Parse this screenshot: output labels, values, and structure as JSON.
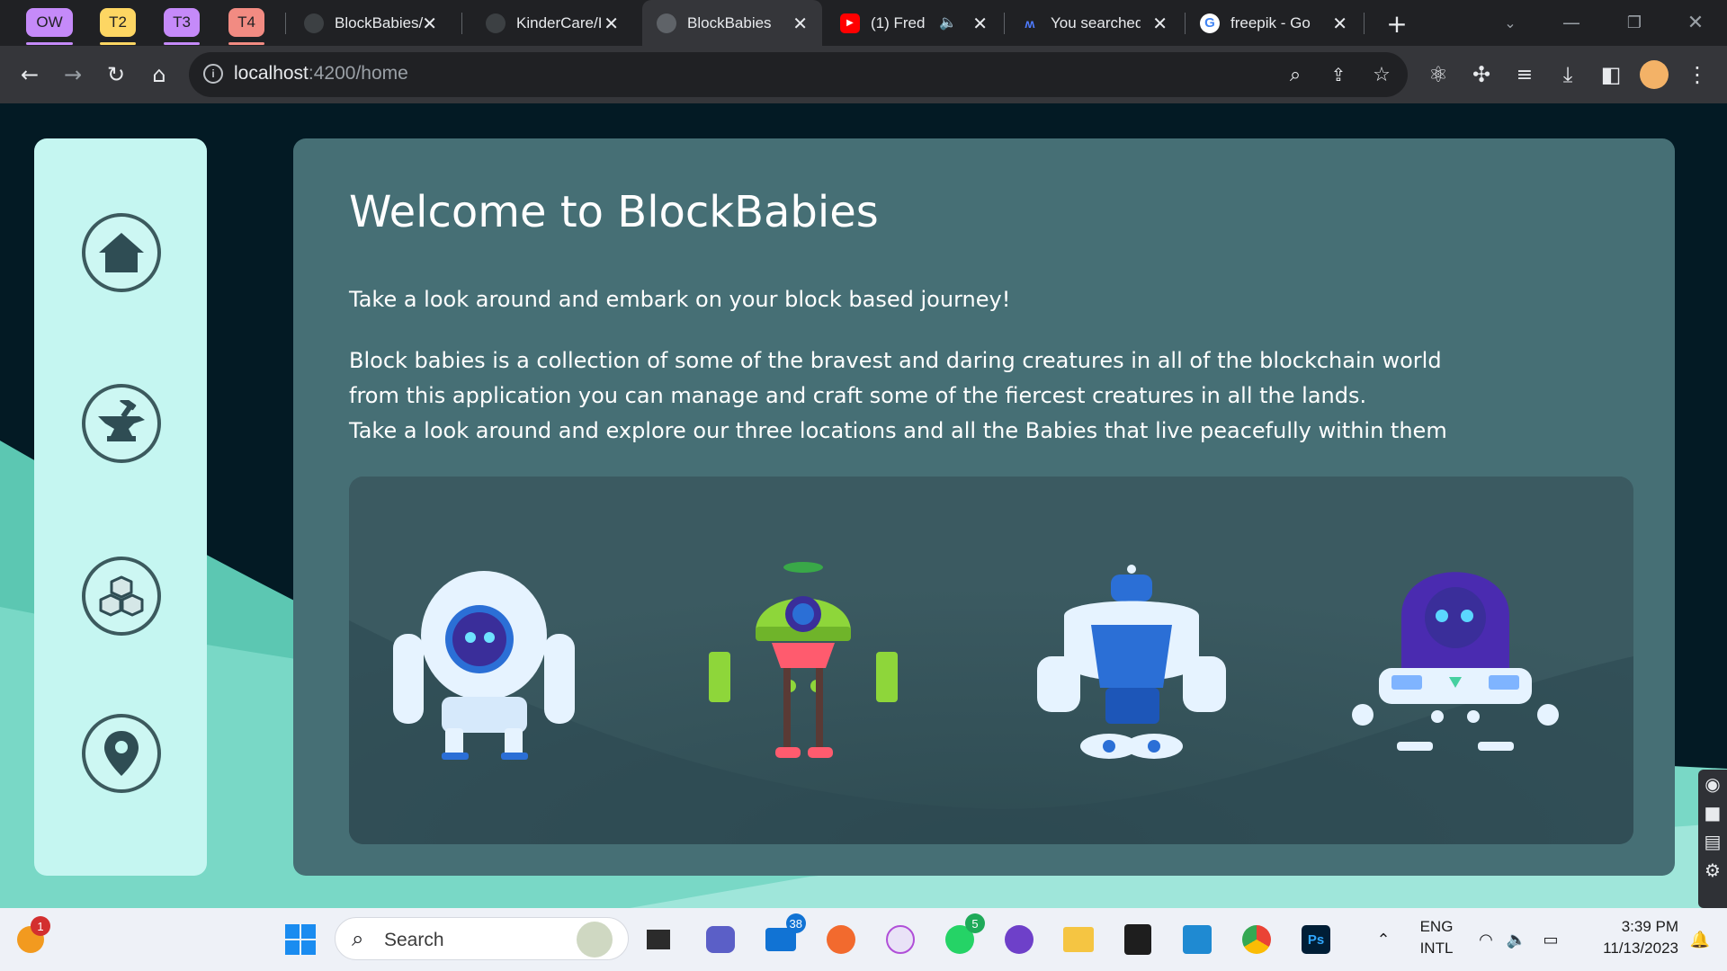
{
  "browser": {
    "tab_groups": [
      {
        "label": "OW",
        "color": "#c58af9"
      },
      {
        "label": "T2",
        "color": "#fdd663"
      },
      {
        "label": "T3",
        "color": "#c58af9"
      },
      {
        "label": "T4",
        "color": "#f28b82"
      }
    ],
    "tabs": [
      {
        "title": "BlockBabies/",
        "favicon": "github-icon"
      },
      {
        "title": "KinderCare/I",
        "favicon": "github-icon"
      },
      {
        "title": "BlockBabies",
        "favicon": "globe-icon"
      },
      {
        "title": "(1) Fred",
        "favicon": "youtube-icon"
      },
      {
        "title": "You searched",
        "favicon": "wordsworth-icon"
      },
      {
        "title": "freepik - Go",
        "favicon": "google-icon"
      }
    ],
    "url_host": "localhost",
    "url_path": ":4200/home"
  },
  "sidebar": {
    "items": [
      {
        "name": "home-icon"
      },
      {
        "name": "anvil-icon"
      },
      {
        "name": "blocks-icon"
      },
      {
        "name": "map-pin-icon"
      }
    ]
  },
  "main": {
    "title": "Welcome to BlockBabies",
    "intro": "Take a look around and embark on your block based journey!",
    "body_lines": [
      "Block babies is a collection of some of the bravest and daring creatures in all of the blockchain world",
      "from this application you can manage and craft some of the fiercest creatures in all the lands.",
      "Take a look around and explore our three locations and all the Babies that live peacefully within them"
    ]
  },
  "taskbar": {
    "weather_badge": "1",
    "search_label": "Search",
    "mail_badge": "38",
    "whatsapp_badge": "5",
    "lang_1": "ENG",
    "lang_2": "INTL",
    "time": "3:39 PM",
    "date": "11/13/2023"
  },
  "colors": {
    "page_bg": "#031a24",
    "sidebar_bg": "#c5f6f1",
    "panel_bg": "#466f75",
    "wave": "#5cc7b2"
  }
}
